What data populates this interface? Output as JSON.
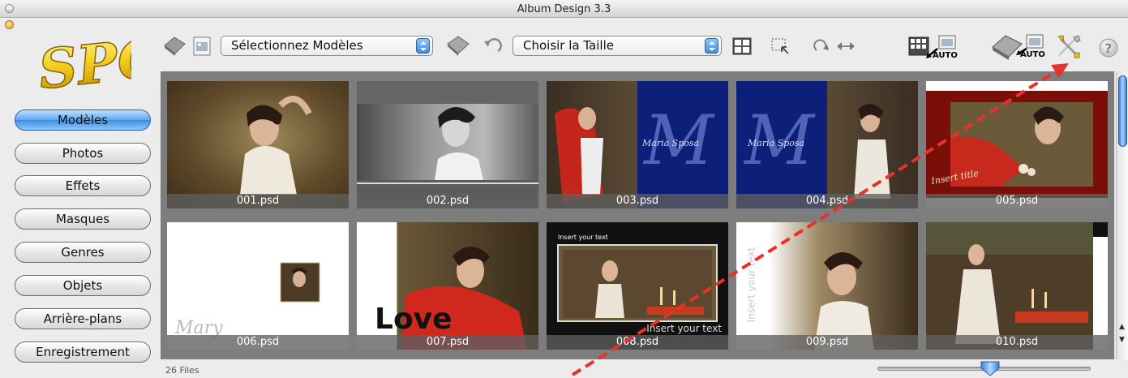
{
  "window": {
    "title": "Album Design 3.3"
  },
  "logo": {
    "text": "SPC"
  },
  "sidebar": {
    "items": [
      {
        "label": "Modèles",
        "active": true
      },
      {
        "label": "Photos",
        "active": false
      },
      {
        "label": "Effets",
        "active": false
      },
      {
        "label": "Masques",
        "active": false
      },
      {
        "label": "Genres",
        "active": false
      },
      {
        "label": "Objets",
        "active": false
      },
      {
        "label": "Arrière-plans",
        "active": false
      },
      {
        "label": "Enregistrement",
        "active": false
      }
    ]
  },
  "toolbar": {
    "template_select": "Sélectionnez Modèles",
    "size_select": "Choisir la Taille",
    "auto_label_1": "AUTO",
    "auto_label_2": "AUTO",
    "icons": [
      "tag-icon",
      "image-doc-icon",
      "book-icon",
      "undo-icon",
      "grid-layout-icon",
      "crop-select-icon",
      "rotate-icon",
      "flip-horizontal-icon",
      "auto-layout-icon",
      "auto-album-icon",
      "tools-icon",
      "help-icon"
    ]
  },
  "gallery": {
    "items": [
      {
        "name": "001.psd"
      },
      {
        "name": "002.psd"
      },
      {
        "name": "003.psd",
        "overlay": "Maria Sposa"
      },
      {
        "name": "004.psd",
        "overlay": "Maria Sposa"
      },
      {
        "name": "005.psd",
        "overlay": "Insert title"
      },
      {
        "name": "006.psd",
        "overlay": "Mary"
      },
      {
        "name": "007.psd",
        "overlay": "Love"
      },
      {
        "name": "008.psd",
        "overlay_top": "Insert your text",
        "overlay_bottom": "Insert your text"
      },
      {
        "name": "009.psd",
        "overlay": "Insert your text"
      },
      {
        "name": "010.psd"
      }
    ]
  },
  "status": {
    "file_count": "26 Files"
  },
  "zoom_slider": {
    "value": 0.48
  },
  "colors": {
    "accent": "#3d8fe3",
    "annotation": "#e8312a"
  }
}
